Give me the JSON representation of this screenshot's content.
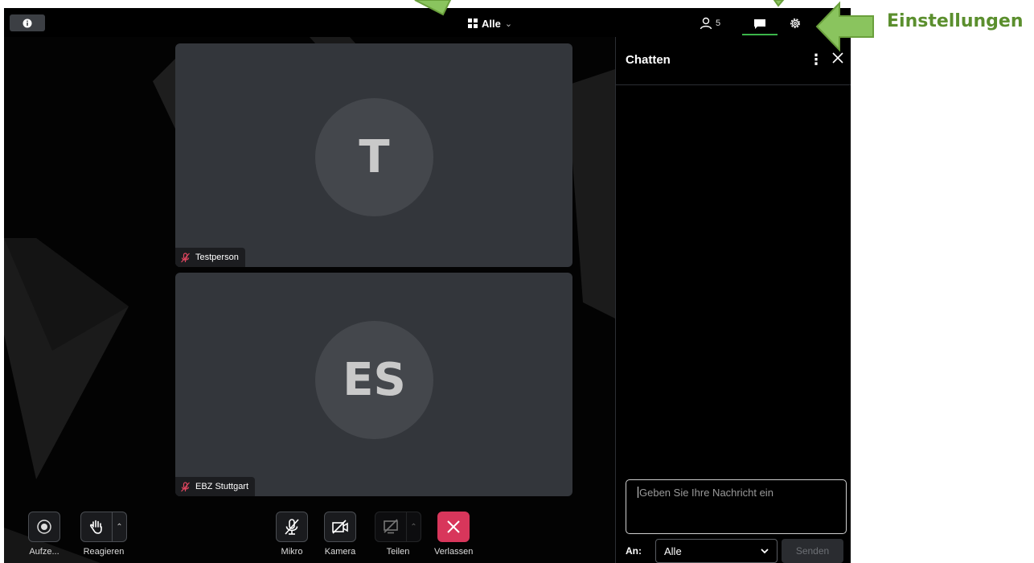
{
  "topbar": {
    "info_icon": "info-icon",
    "layout_label": "Alle",
    "layout_icon": "grid-icon",
    "participants_count": "5",
    "participants_icon": "person-icon",
    "chat_icon": "chat-bubble-icon",
    "settings_icon": "gear-icon"
  },
  "tiles": [
    {
      "initials": "T",
      "name": "Testperson",
      "mic_icon": "mic-off-icon"
    },
    {
      "initials": "ES",
      "name": "EBZ Stuttgart",
      "mic_icon": "mic-off-icon"
    }
  ],
  "controls": {
    "record_label": "Aufze...",
    "react_label": "Reagieren",
    "mic_label": "Mikro",
    "camera_label": "Kamera",
    "share_label": "Teilen",
    "leave_label": "Verlassen"
  },
  "chat": {
    "title": "Chatten",
    "message_placeholder": "Geben Sie Ihre Nachricht ein",
    "to_label": "An:",
    "to_value": "Alle",
    "send_label": "Senden"
  },
  "annotation": {
    "settings_label": "Einstellungen",
    "arrow_color": "#8ac45e"
  },
  "colors": {
    "accent": "#3bb54a",
    "leave": "#d8365b",
    "tile": "#33363b"
  }
}
